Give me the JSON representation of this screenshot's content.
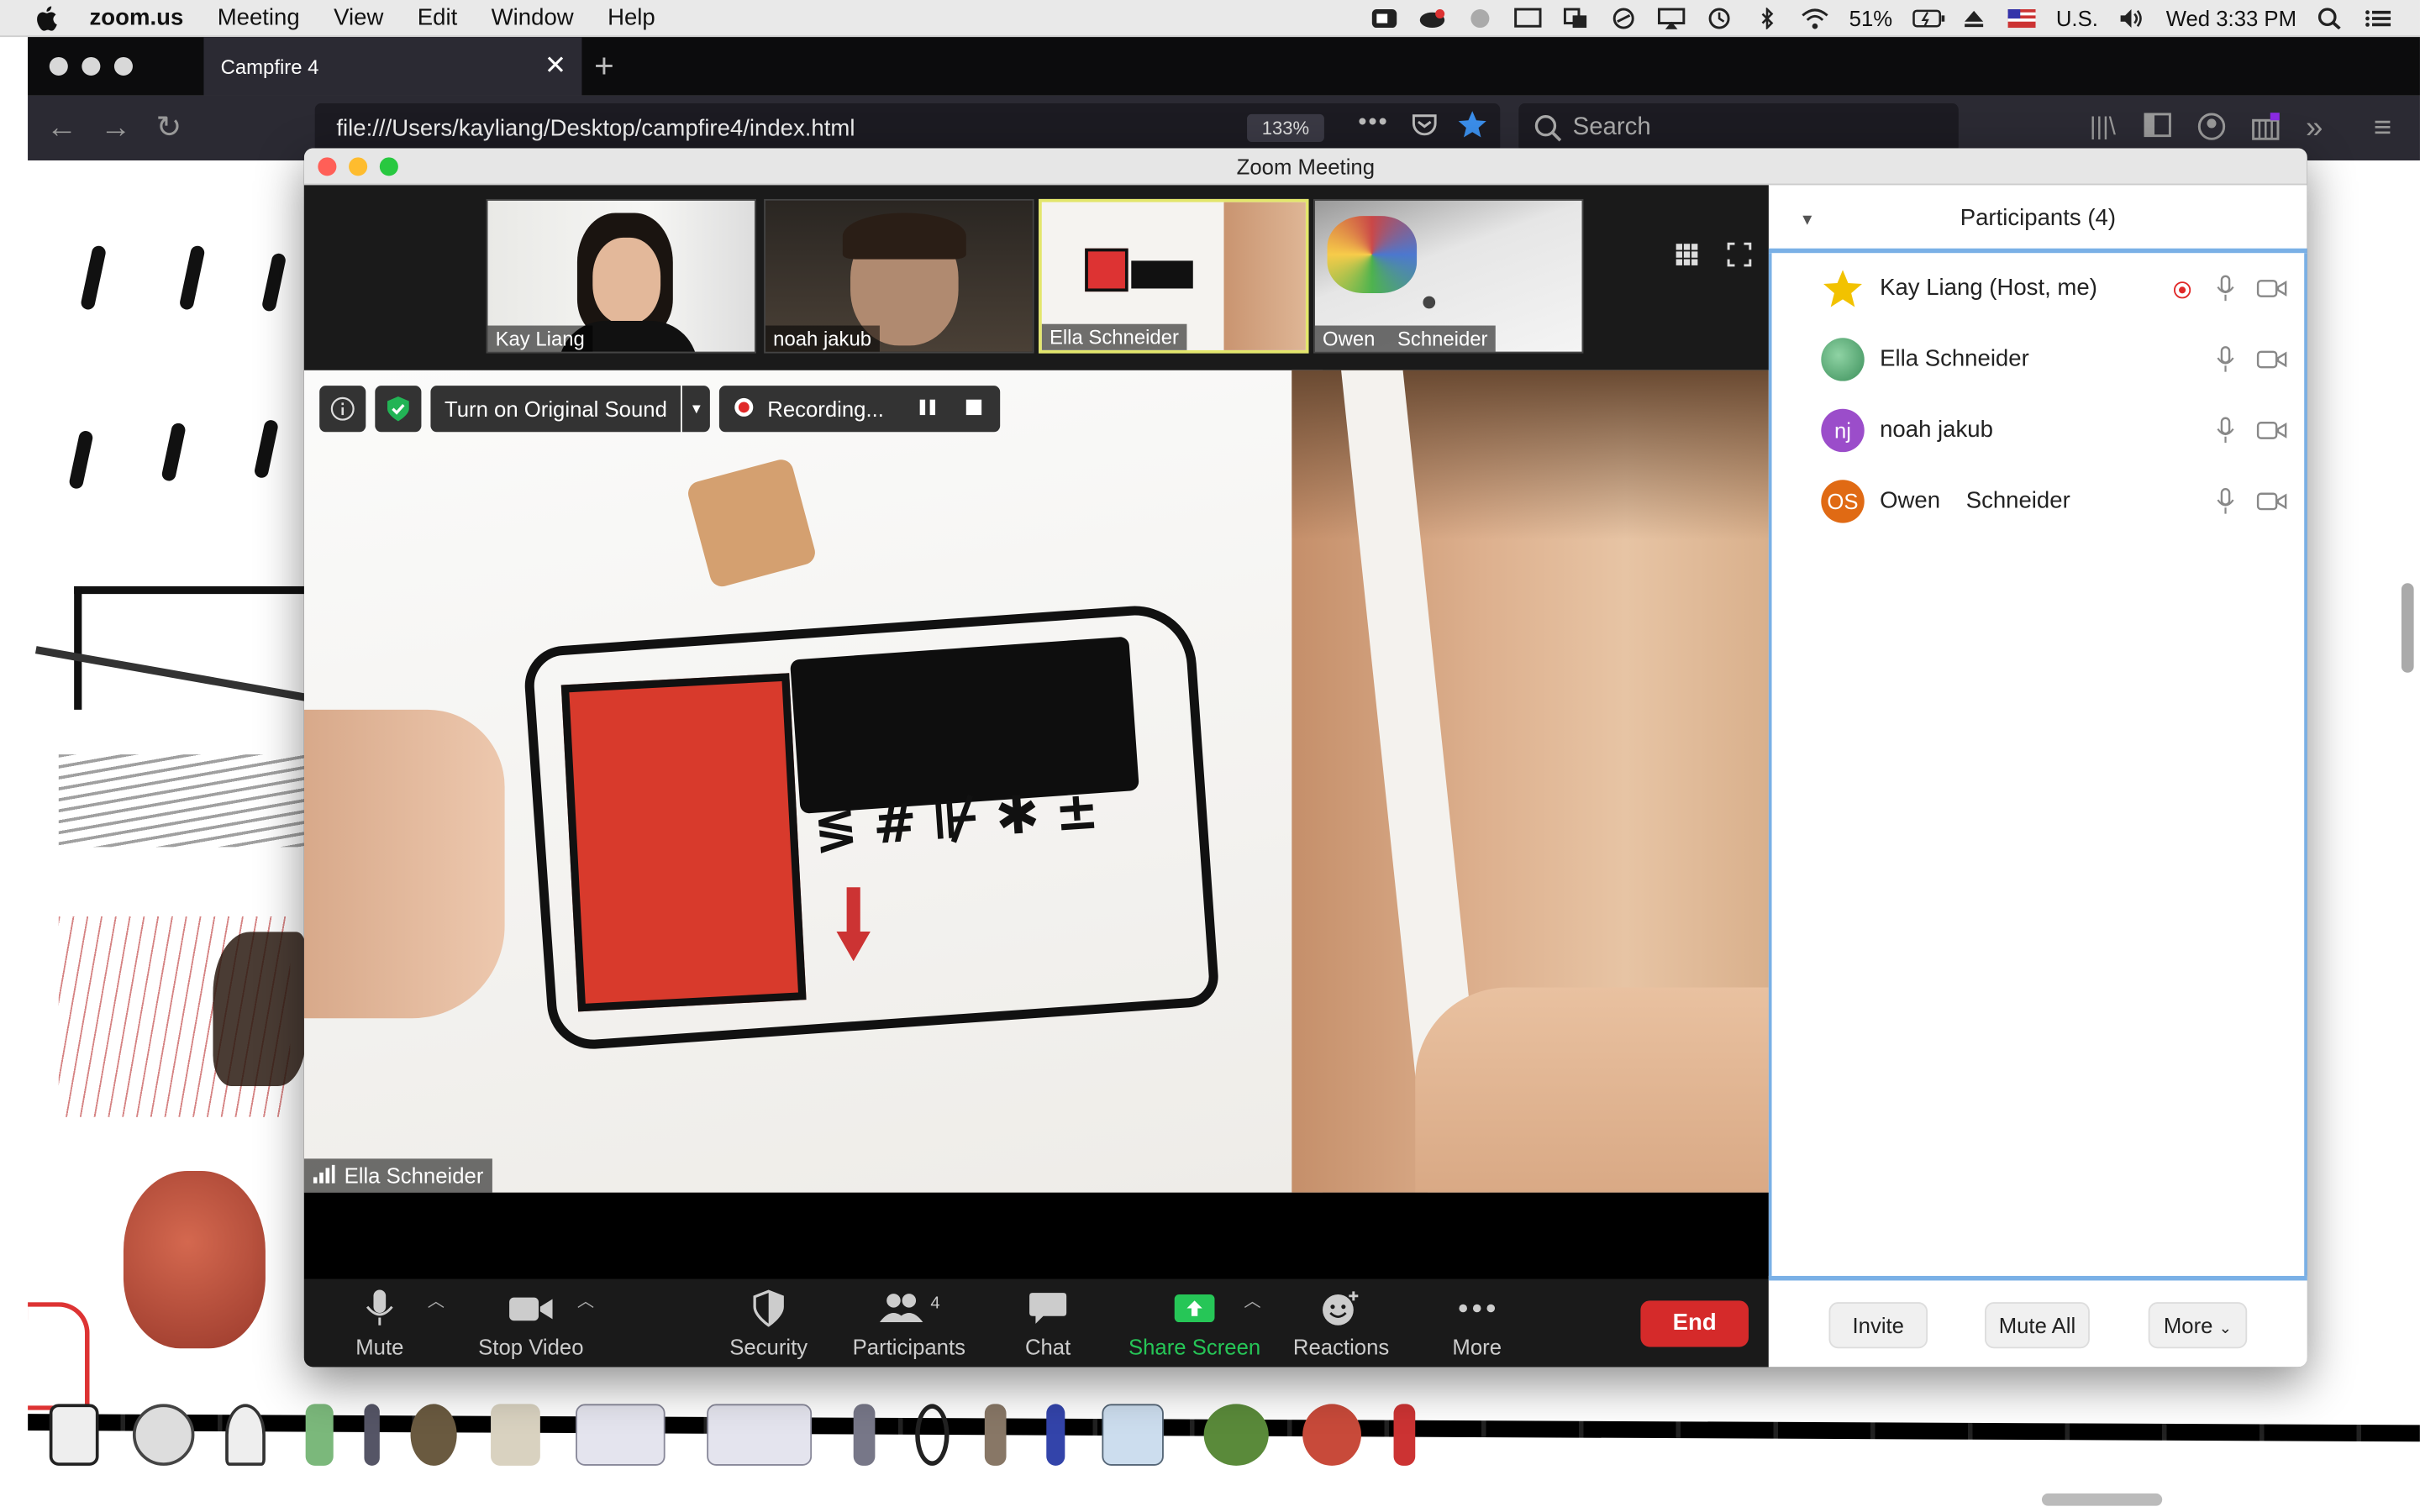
{
  "menubar": {
    "app": "zoom.us",
    "items": [
      "Meeting",
      "View",
      "Edit",
      "Window",
      "Help"
    ],
    "battery": "51%",
    "input_source": "U.S.",
    "clock": "Wed 3:33 PM"
  },
  "browser": {
    "tab_title": "Campfire 4",
    "url": "file:///Users/kayliang/Desktop/campfire4/index.html",
    "zoom": "133%",
    "search_placeholder": "Search"
  },
  "zoom": {
    "window_title": "Zoom Meeting",
    "thumbnails": [
      {
        "name": "Kay Liang"
      },
      {
        "name": "noah jakub"
      },
      {
        "name": "Ella Schneider"
      },
      {
        "name": "Owen    Schneider"
      }
    ],
    "video_toolbar": {
      "original_sound": "Turn on Original Sound",
      "recording": "Recording..."
    },
    "active_speaker": "Ella Schneider",
    "controls": {
      "mute": "Mute",
      "stop_video": "Stop Video",
      "security": "Security",
      "participants": "Participants",
      "participants_count": "4",
      "chat": "Chat",
      "share_screen": "Share Screen",
      "reactions": "Reactions",
      "more": "More",
      "end": "End"
    },
    "panel": {
      "title": "Participants (4)",
      "participants": [
        {
          "name": "Kay Liang (Host, me)",
          "initials": "",
          "color": "#f2c200"
        },
        {
          "name": "Ella Schneider",
          "initials": "",
          "color": "#47a56a"
        },
        {
          "name": "noah jakub",
          "initials": "nj",
          "color": "#9b4dca"
        },
        {
          "name": "Owen    Schneider",
          "initials": "OS",
          "color": "#e06a14"
        }
      ],
      "invite": "Invite",
      "mute_all": "Mute All",
      "more": "More"
    }
  }
}
